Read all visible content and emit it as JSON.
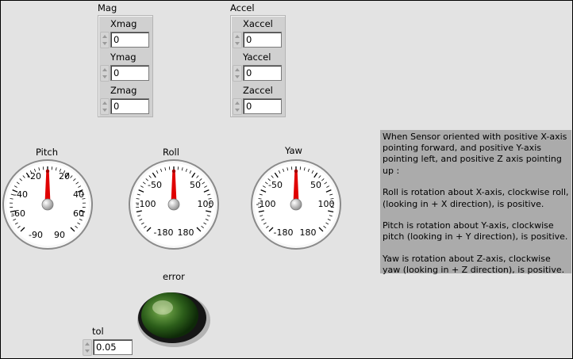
{
  "mag": {
    "title": "Mag",
    "controls": [
      {
        "label": "Xmag",
        "value": "0"
      },
      {
        "label": "Ymag",
        "value": "0"
      },
      {
        "label": "Zmag",
        "value": "0"
      }
    ]
  },
  "accel": {
    "title": "Accel",
    "controls": [
      {
        "label": "Xaccel",
        "value": "0"
      },
      {
        "label": "Yaccel",
        "value": "0"
      },
      {
        "label": "Zaccel",
        "value": "0"
      }
    ]
  },
  "gauges": [
    {
      "id": "pitch",
      "title": "Pitch",
      "min": -90,
      "max": 90,
      "value": 0,
      "labels": [
        "-20",
        "20",
        "-40",
        "40",
        "-60",
        "60",
        "-90",
        "90"
      ]
    },
    {
      "id": "roll",
      "title": "Roll",
      "min": -180,
      "max": 180,
      "value": 0,
      "labels": [
        "-50",
        "50",
        "-100",
        "100",
        "-180",
        "180"
      ]
    },
    {
      "id": "yaw",
      "title": "Yaw",
      "min": -180,
      "max": 180,
      "value": 0,
      "labels": [
        "-50",
        "50",
        "-100",
        "100",
        "-180",
        "180"
      ]
    }
  ],
  "error": {
    "label": "error",
    "state": "off",
    "color": "#2f7a1e"
  },
  "tol": {
    "label": "tol",
    "value": "0.05"
  },
  "note": {
    "paragraphs": [
      "When Sensor oriented with positive X-axis pointing forward, and positive Y-axis pointing left, and positive Z axis pointing up :",
      "Roll is rotation about X-axis, clockwise roll, (looking in + X direction), is positive.",
      "Pitch is rotation about Y-axis, clockwise pitch (looking in + Y direction), is positive.",
      "Yaw is rotation about Z-axis, clockwise yaw (looking in + Z direction), is positive."
    ]
  },
  "colors": {
    "needle": "#e00000",
    "panel": "#e3e3e3",
    "cluster": "#d0d0d0",
    "note": "#ababab"
  }
}
